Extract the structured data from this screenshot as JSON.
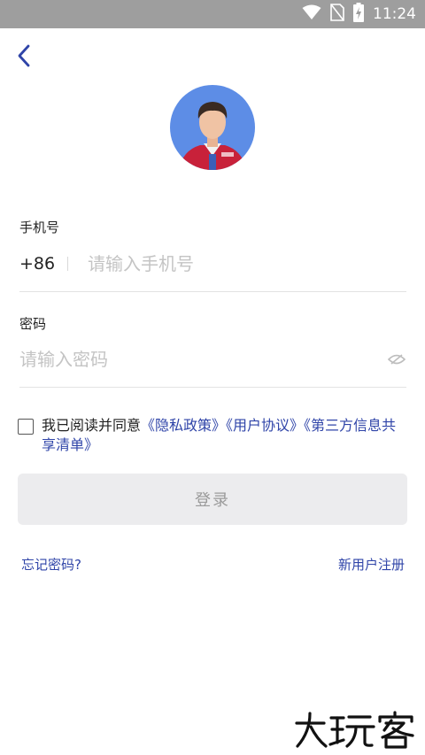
{
  "status_bar": {
    "time": "11:24"
  },
  "form": {
    "phone_label": "手机号",
    "country_code": "+86",
    "phone_placeholder": "请输入手机号",
    "password_label": "密码",
    "password_placeholder": "请输入密码"
  },
  "agreement": {
    "prefix": "我已阅读并同意",
    "privacy_policy": "《隐私政策》",
    "user_agreement": "《用户协议》",
    "third_party_list": "《第三方信息共享清单》",
    "checked": false
  },
  "login_button": "登录",
  "forgot_password": "忘记密码?",
  "register": "新用户注册",
  "watermark_text": "大玩客",
  "colors": {
    "link": "#2f44a8",
    "status_bar": "#9e9e9e",
    "avatar_bg": "#5d8de6",
    "button_bg": "#ececee"
  },
  "icons": [
    "wifi-icon",
    "no-sim-icon",
    "battery-charging-icon",
    "back-arrow-icon",
    "eye-hidden-icon"
  ]
}
